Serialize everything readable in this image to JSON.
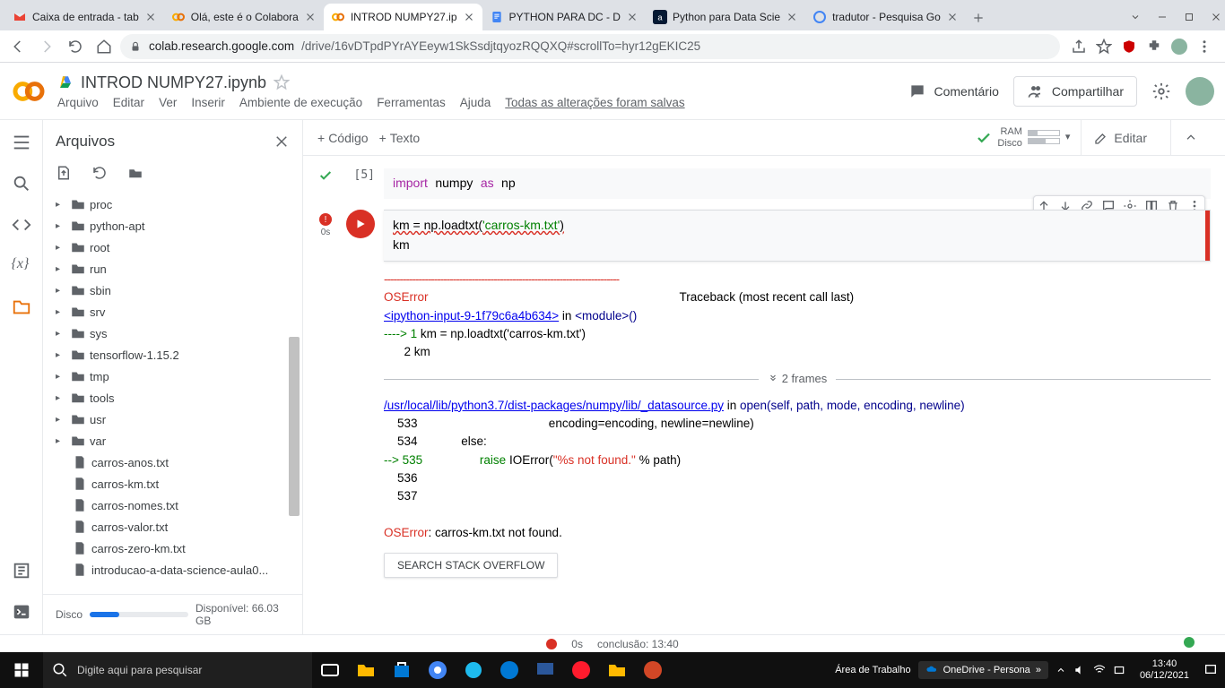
{
  "chrome": {
    "tabs": [
      {
        "title": "Caixa de entrada - tab",
        "favicon": "gmail"
      },
      {
        "title": "Olá, este é o Colabora",
        "favicon": "colab"
      },
      {
        "title": "INTROD NUMPY27.ip",
        "favicon": "colab",
        "active": true
      },
      {
        "title": "PYTHON PARA DC - D",
        "favicon": "gdocs"
      },
      {
        "title": "Python para Data Scie",
        "favicon": "alura"
      },
      {
        "title": "tradutor - Pesquisa Go",
        "favicon": "google"
      }
    ],
    "url_host": "colab.research.google.com",
    "url_path": "/drive/16vDTpdPYrAYEeyw1SkSsdjtqyozRQQXQ#scrollTo=hyr12gEKIC25"
  },
  "colab": {
    "filename": "INTROD NUMPY27.ipynb",
    "menus": {
      "arquivo": "Arquivo",
      "editar": "Editar",
      "ver": "Ver",
      "inserir": "Inserir",
      "ambiente": "Ambiente de execução",
      "ferramentas": "Ferramentas",
      "ajuda": "Ajuda",
      "savemsg": "Todas as alterações foram salvas"
    },
    "header_buttons": {
      "comentario": "Comentário",
      "compartilhar": "Compartilhar"
    },
    "toolbar": {
      "codigo": "Código",
      "texto": "Texto",
      "editar": "Editar",
      "ram": "RAM",
      "disco": "Disco"
    },
    "status": {
      "time": "0s",
      "conclusao": "conclusão: 13:40"
    }
  },
  "files_panel": {
    "title": "Arquivos",
    "disk_label": "Disco",
    "disk_avail": "Disponível: 66.03 GB",
    "folders": [
      "proc",
      "python-apt",
      "root",
      "run",
      "sbin",
      "srv",
      "sys",
      "tensorflow-1.15.2",
      "tmp",
      "tools",
      "usr",
      "var"
    ],
    "files": [
      "carros-anos.txt",
      "carros-km.txt",
      "carros-nomes.txt",
      "carros-valor.txt",
      "carros-zero-km.txt",
      "introducao-a-data-science-aula0..."
    ]
  },
  "cells": {
    "c1": {
      "prompt": "[5]",
      "line1_a": "import",
      "line1_b": "numpy",
      "line1_c": "as",
      "line1_d": "np"
    },
    "c2": {
      "err_time": "0s",
      "line1_a": "km = np.loadtxt(",
      "line1_b": "'carros-km.txt'",
      "line1_c": ")",
      "line2": "km"
    },
    "output": {
      "dashes": "---------------------------------------------------------------------------",
      "oserror": "OSError",
      "traceback": "Traceback (most recent call last)",
      "ipython_link": "<ipython-input-9-1f79c6a4b634>",
      "in_module": " in ",
      "module_call": "<module>",
      "paren": "()",
      "arrow1": "----> 1 ",
      "l1_code": "km = np.loadtxt('carros-km.txt')",
      "l2": "      2 km",
      "frames": "2 frames",
      "path_link": "/usr/local/lib/python3.7/dist-packages/numpy/lib/_datasource.py",
      "in": " in ",
      "open": "open",
      "open_args": "(self, path, mode, encoding, newline)",
      "l533": "    533                                       encoding=encoding, newline=newline)",
      "l534": "    534             else:",
      "l535a": "--> 535                 ",
      "l535b": "raise",
      "l535c": " IOError(",
      "l535d": "\"%s not found.\"",
      "l535e": " % path)",
      "l536": "    536 ",
      "l537": "    537 ",
      "final_a": "OSError",
      "final_b": ": carros-km.txt not found.",
      "so_btn": "SEARCH STACK OVERFLOW"
    }
  },
  "taskbar": {
    "search_placeholder": "Digite aqui para pesquisar",
    "desktop": "Área de Trabalho",
    "onedrive": "OneDrive - Persona",
    "time": "13:40",
    "date": "06/12/2021"
  }
}
